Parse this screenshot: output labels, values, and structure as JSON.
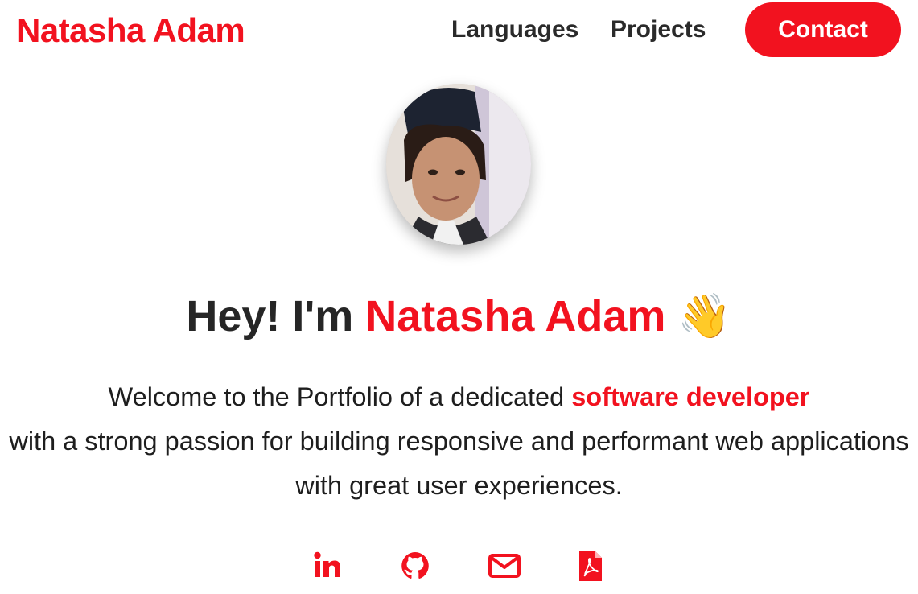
{
  "header": {
    "brand": "Natasha Adam",
    "nav": [
      {
        "label": "Languages"
      },
      {
        "label": "Projects"
      }
    ],
    "contact_label": "Contact"
  },
  "hero": {
    "title_prefix": "Hey! I'm ",
    "title_name": "Natasha Adam",
    "wave_emoji": "👋",
    "subtitle_part1": "Welcome to the Portfolio of a dedicated ",
    "subtitle_highlight": "software developer",
    "subtitle_part2": " with a strong passion for building responsive and performant web applications with great user experiences."
  },
  "socials": [
    {
      "icon": "linkedin-icon"
    },
    {
      "icon": "github-icon"
    },
    {
      "icon": "email-icon"
    },
    {
      "icon": "pdf-resume-icon"
    }
  ],
  "colors": {
    "accent": "#f2121f",
    "text": "#222222",
    "background": "#ffffff"
  }
}
